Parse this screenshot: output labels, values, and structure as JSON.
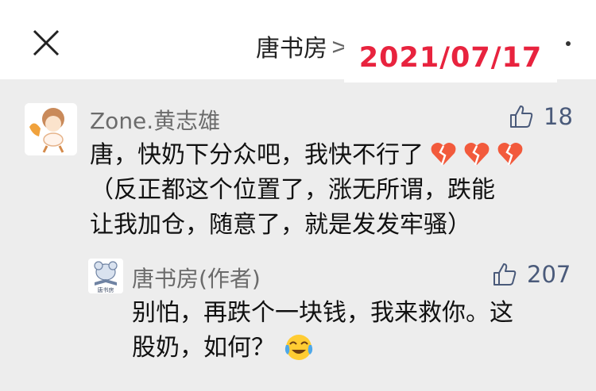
{
  "header": {
    "title": "唐书房",
    "chevron": ">",
    "date_stamp": "2021/07/17"
  },
  "comment": {
    "author": "Zone.黄志雄",
    "likes": "18",
    "lines": [
      "唐，快奶下分众吧，我快不行了",
      "（反正都这个位置了，涨无所谓，跌能",
      "让我加仓，随意了，就是发发牢骚）"
    ],
    "emoji": [
      "broken-heart",
      "broken-heart",
      "broken-heart"
    ]
  },
  "reply": {
    "author": "唐书房(作者)",
    "avatar_text": "唐书房",
    "likes": "207",
    "lines": [
      "别怕，再跌个一块钱，我来救你。这",
      "股奶，如何？"
    ],
    "emoji": "face-with-tears-of-joy"
  },
  "colors": {
    "background": "#ededed",
    "date_red": "#e8233e",
    "like_blue": "#4a5a7a"
  }
}
